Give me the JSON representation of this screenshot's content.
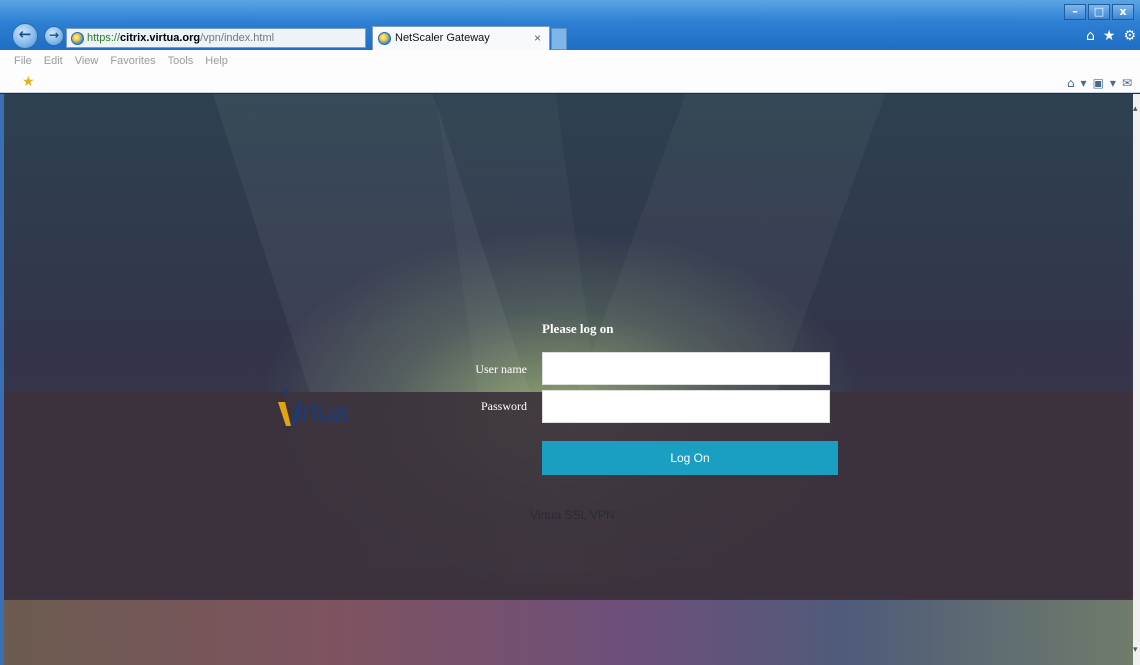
{
  "browser": {
    "url_scheme": "https://",
    "url_domain": "citrix.virtua.org",
    "url_path": "/vpn/index.html",
    "tab_title": "NetScaler Gateway",
    "tab_close": "×",
    "menu": [
      "File",
      "Edit",
      "View",
      "Favorites",
      "Tools",
      "Help"
    ]
  },
  "login": {
    "title": "Please log on",
    "username_label": "User name",
    "password_label": "Password",
    "username_value": "",
    "password_value": "",
    "button_label": "Log On"
  },
  "brand": {
    "logo_text": "irtua"
  },
  "footer": {
    "text": "Virtua SSL VPN"
  },
  "colors": {
    "button": "#1a9ec2",
    "logo": "#1a3d7a",
    "logo_accent": "#e2a417"
  }
}
